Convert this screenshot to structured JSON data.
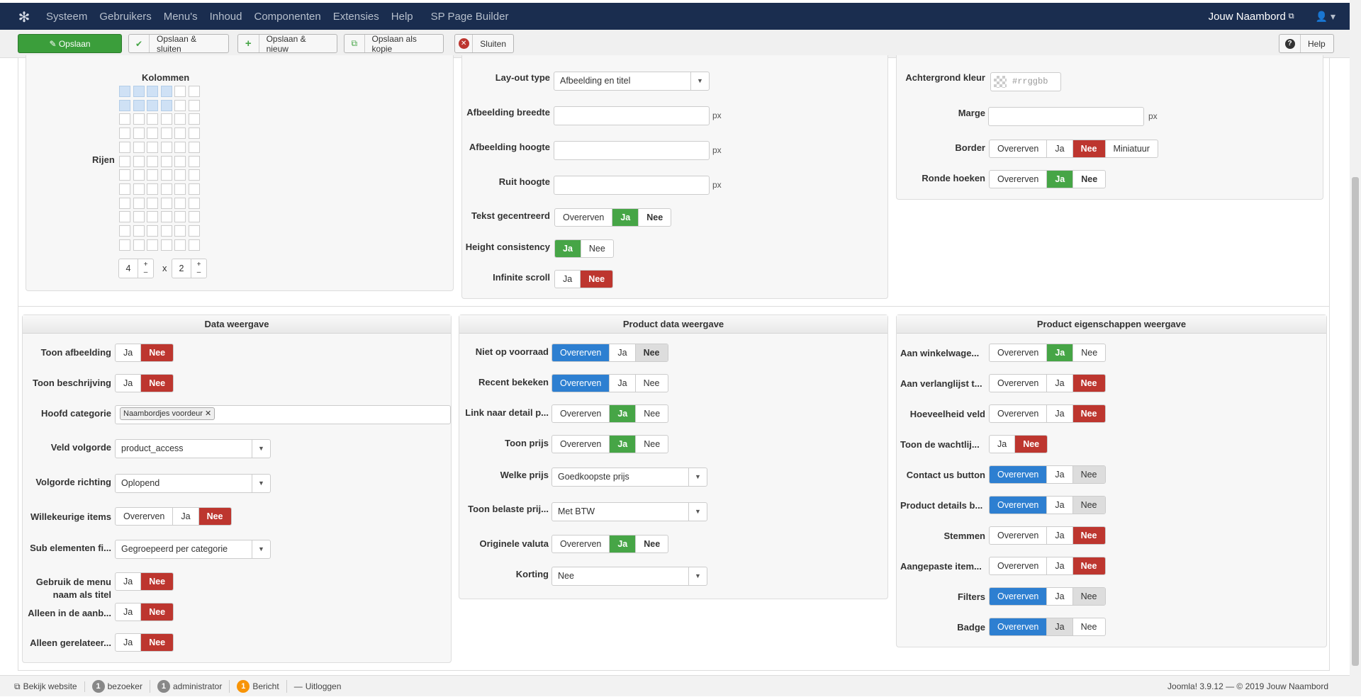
{
  "topbar": {
    "menu": [
      "Systeem",
      "Gebruikers",
      "Menu's",
      "Inhoud",
      "Componenten",
      "Extensies",
      "Help",
      "SP Page Builder"
    ],
    "site_name": "Jouw Naambord"
  },
  "toolbar": {
    "save": "Opslaan",
    "save_close": "Opslaan & sluiten",
    "save_new": "Opslaan & nieuw",
    "save_copy": "Opslaan als kopie",
    "close": "Sluiten",
    "help": "Help"
  },
  "layout": {
    "kolommen": "Kolommen",
    "rijen": "Rijen",
    "cols_value": "4",
    "x": "x",
    "rows_value": "2",
    "plus": "+",
    "minus": "–"
  },
  "middle_top": {
    "layout_type_label": "Lay-out type",
    "layout_type_value": "Afbeelding en titel",
    "img_width_label": "Afbeelding breedte",
    "img_height_label": "Afbeelding hoogte",
    "grid_height_label": "Ruit hoogte",
    "px": "px",
    "text_centered_label": "Tekst gecentreerd",
    "height_consistency_label": "Height consistency",
    "infinite_scroll_label": "Infinite scroll"
  },
  "right_top": {
    "bg_color_label": "Achtergrond kleur",
    "bg_color_placeholder": "#rrggbb",
    "margin_label": "Marge",
    "px": "px",
    "border_label": "Border",
    "rounded_label": "Ronde hoeken"
  },
  "opts": {
    "override": "Overerven",
    "yes": "Ja",
    "no": "Nee",
    "thumbnail": "Miniatuur"
  },
  "data_panel": {
    "title": "Data weergave",
    "show_image": "Toon afbeelding",
    "show_desc": "Toon beschrijving",
    "main_category": "Hoofd categorie",
    "category_chip": "Naambordjes voordeur",
    "field_order": "Veld volgorde",
    "field_order_value": "product_access",
    "order_dir": "Volgorde richting",
    "order_dir_value": "Oplopend",
    "random_items": "Willekeurige items",
    "sub_elements": "Sub elementen fi...",
    "sub_elements_value": "Gegroepeerd per categorie",
    "menu_title_1": "Gebruik de menu",
    "menu_title_2": "naam als titel",
    "only_in_offer": "Alleen in de aanb...",
    "only_related": "Alleen gerelateer..."
  },
  "product_panel": {
    "title": "Product data weergave",
    "out_of_stock": "Niet op voorraad",
    "recently_viewed": "Recent bekeken",
    "link_detail": "Link naar detail p...",
    "show_price": "Toon prijs",
    "which_price": "Welke prijs",
    "which_price_value": "Goedkoopste prijs",
    "show_taxed": "Toon belaste prij...",
    "show_taxed_value": "Met BTW",
    "original_currency": "Originele valuta",
    "discount": "Korting",
    "discount_value": "Nee"
  },
  "props_panel": {
    "title": "Product eigenschappen weergave",
    "cart": "Aan winkelwage...",
    "wishlist": "Aan verlanglijst t...",
    "quantity": "Hoeveelheid veld",
    "waitlist": "Toon de wachtlij...",
    "contact": "Contact us button",
    "details_button": "Product details b...",
    "votes": "Stemmen",
    "custom_items": "Aangepaste item...",
    "filters": "Filters",
    "badge": "Badge"
  },
  "footer": {
    "view_site": "Bekijk website",
    "visitors_count": "1",
    "visitors": "bezoeker",
    "admins_count": "1",
    "admins": "administrator",
    "messages_count": "1",
    "messages": "Bericht",
    "logout": "Uitloggen",
    "version": "Joomla! 3.9.12 — © 2019 Jouw Naambord"
  },
  "colors": {
    "topbar": "#1a2d4f",
    "green": "#46a546",
    "red": "#bd362f",
    "blue": "#2d7fd1"
  }
}
